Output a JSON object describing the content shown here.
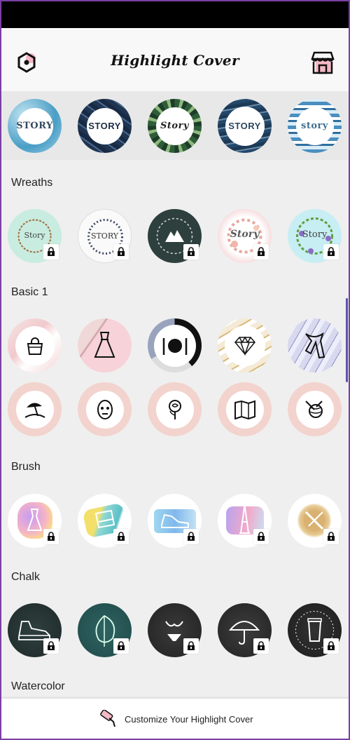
{
  "app": {
    "title": "Highlight Cover"
  },
  "icons": {
    "settings": "hexagon-settings-icon",
    "store": "store-icon",
    "lock": "lock-icon",
    "customize": "paint-roller-icon"
  },
  "colors": {
    "accent": "#f0a0b0",
    "frame": "#7b3fa3"
  },
  "top_row": {
    "items": [
      {
        "label": "STORY",
        "style": "blue-watercolor"
      },
      {
        "label": "STORY",
        "style": "navy-marble"
      },
      {
        "label": "Story",
        "style": "palm-leaves"
      },
      {
        "label": "STORY",
        "style": "ocean-waves"
      },
      {
        "label": "story",
        "style": "blue-stripes"
      }
    ]
  },
  "sections": [
    {
      "title": "Wreaths",
      "items": [
        {
          "label": "Story",
          "icon": "laurel-wreath-icon",
          "locked": true
        },
        {
          "label": "STORY",
          "icon": "leaf-wreath-icon",
          "locked": true
        },
        {
          "label": "",
          "icon": "mountain-icon",
          "locked": true
        },
        {
          "label": "Story",
          "icon": "floral-wreath-icon",
          "locked": true
        },
        {
          "label": "Story",
          "icon": "violet-wreath-icon",
          "locked": true
        }
      ]
    },
    {
      "title": "Basic 1",
      "items": [
        {
          "icon": "handbag-icon",
          "locked": false
        },
        {
          "icon": "dress-icon",
          "locked": false
        },
        {
          "icon": "plate-cutlery-icon",
          "locked": false
        },
        {
          "icon": "diamond-icon",
          "locked": false
        },
        {
          "icon": "scarf-icon",
          "locked": false
        },
        {
          "icon": "beach-umbrella-icon",
          "locked": false
        },
        {
          "icon": "face-mask-icon",
          "locked": false
        },
        {
          "icon": "rose-icon",
          "locked": false
        },
        {
          "icon": "map-icon",
          "locked": false
        },
        {
          "icon": "yarn-ball-icon",
          "locked": false
        }
      ]
    },
    {
      "title": "Brush",
      "items": [
        {
          "icon": "gown-icon",
          "locked": true
        },
        {
          "icon": "piano-icon",
          "locked": true
        },
        {
          "icon": "sneaker-icon",
          "locked": true
        },
        {
          "icon": "eiffel-tower-icon",
          "locked": true
        },
        {
          "icon": "sewing-icon",
          "locked": true
        }
      ]
    },
    {
      "title": "Chalk",
      "items": [
        {
          "icon": "high-top-sneaker-icon",
          "locked": true
        },
        {
          "icon": "monstera-leaf-icon",
          "locked": true
        },
        {
          "icon": "bikini-icon",
          "locked": true
        },
        {
          "icon": "umbrella-icon",
          "locked": true
        },
        {
          "icon": "coffee-cup-icon",
          "locked": true
        }
      ]
    },
    {
      "title": "Watercolor",
      "items": []
    }
  ],
  "bottom": {
    "label": "Customize Your Highlight Cover"
  }
}
